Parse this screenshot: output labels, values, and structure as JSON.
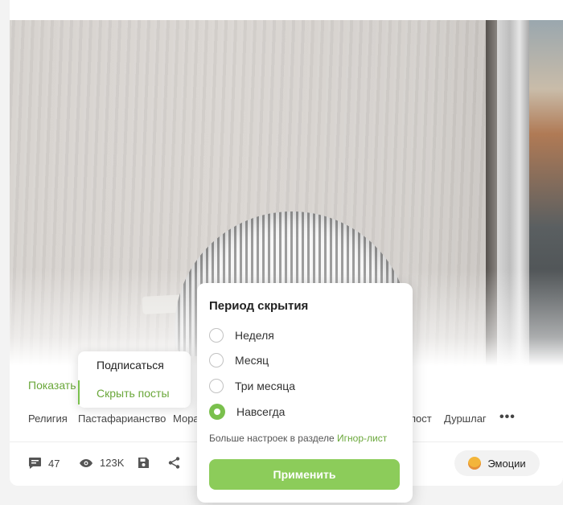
{
  "post": {
    "show_link": "Показать",
    "tags": [
      "Религия",
      "Пастафарианство",
      "Мора",
      "пост",
      "Дуршлаг"
    ],
    "more_label": "•••"
  },
  "stats": {
    "comments": "47",
    "views": "123K"
  },
  "emotions_button": "Эмоции",
  "subscribe_menu": {
    "subscribe": "Подписаться",
    "hide_posts": "Скрыть посты"
  },
  "hide_popup": {
    "title": "Период скрытия",
    "options": [
      {
        "label": "Неделя",
        "checked": false
      },
      {
        "label": "Месяц",
        "checked": false
      },
      {
        "label": "Три месяца",
        "checked": false
      },
      {
        "label": "Навсегда",
        "checked": true
      }
    ],
    "note_text": "Больше настроек в разделе ",
    "note_link": "Игнор-лист",
    "apply_label": "Применить"
  },
  "colors": {
    "accent_green": "#6aa73a",
    "button_green": "#8ccc5a",
    "radio_checked": "#7ac04d"
  }
}
